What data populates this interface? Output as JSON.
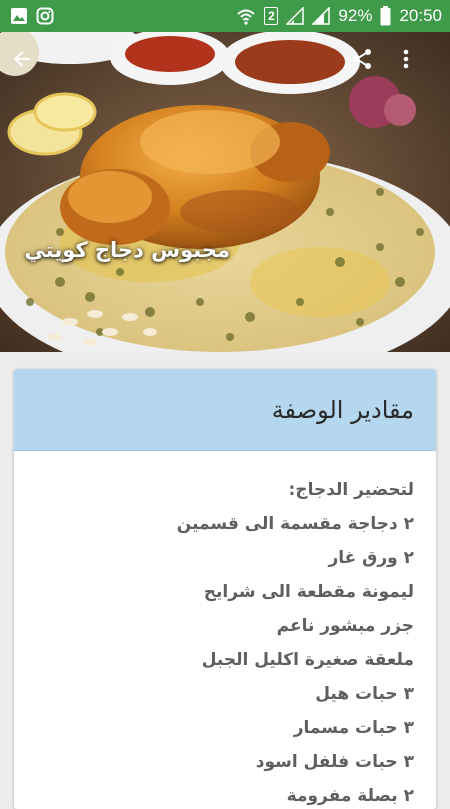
{
  "status_bar": {
    "battery_percent": "92%",
    "time": "20:50",
    "sim_label": "2",
    "icons": [
      "gallery-icon",
      "instagram-icon",
      "wifi-icon",
      "sim-2-icon",
      "signal-icon",
      "signal-icon",
      "battery-icon"
    ]
  },
  "hero": {
    "title": "مجبوس دجاج كويتي",
    "image": "roast-chicken-on-rice-image",
    "back_icon": "back-arrow-icon",
    "share_icon": "share-icon",
    "menu_icon": "more-vert-icon"
  },
  "card": {
    "title": "مقادير الوصفة",
    "header_color": "#b5d6ef",
    "ingredients": [
      "لتحضير الدجاج:",
      "٢ دجاجة مقسمة الى قسمين",
      "٢ ورق غار",
      "ليمونة مقطعة الى شرايح",
      "جزر مبشور ناعم",
      "ملعقة صغيرة اكليل الجبل",
      "٣ حبات هيل",
      "٣ حبات مسمار",
      "٣ حبات فلفل اسود",
      "٢ بصلة مفرومة"
    ]
  },
  "colors": {
    "status_bar": "#3f9a4a",
    "background": "#ececec",
    "text": "#5f5f5f"
  }
}
